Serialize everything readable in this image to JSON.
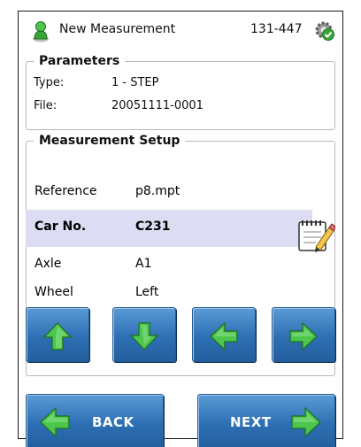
{
  "header": {
    "title": "New Measurement",
    "code": "131-447",
    "person_icon": "person-icon",
    "settings_icon": "gear-check-icon"
  },
  "parameters": {
    "legend": "Parameters",
    "rows": [
      {
        "label": "Type:",
        "value": "1 - STEP"
      },
      {
        "label": "File:",
        "value": "20051111-0001"
      }
    ]
  },
  "setup": {
    "legend": "Measurement Setup",
    "rows": [
      {
        "label": "Reference",
        "value": "p8.mpt"
      },
      {
        "label": "Car No.",
        "value": "C231"
      },
      {
        "label": "Axle",
        "value": "A1"
      },
      {
        "label": "Wheel",
        "value": "Left"
      }
    ],
    "selected_row": "Car No.",
    "edit_icon": "notepad-pencil-icon"
  },
  "arrow_buttons": [
    "up-arrow-icon",
    "down-arrow-icon",
    "left-arrow-icon",
    "right-arrow-icon"
  ],
  "nav": {
    "back_label": "BACK",
    "next_label": "NEXT"
  },
  "colors": {
    "button_blue": "#2d6fb3",
    "arrow_green": "#4cc64c",
    "selection": "#dcdcf2"
  }
}
